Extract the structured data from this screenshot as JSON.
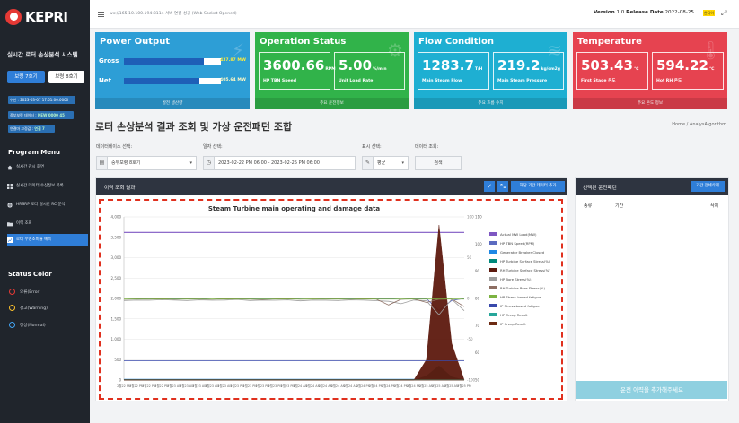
{
  "sidebar": {
    "logo_text": "KEPRI",
    "system_title": "실시간 로터 손상분석 시스템",
    "unit_buttons": [
      "보령 7호기",
      "보령 8호기"
    ],
    "info": [
      {
        "label": "수신 :",
        "value": "2023-03-07 17:51:00.0000"
      },
      {
        "label": "중부보령 데이터 :",
        "value": "NEW 0000 45"
      },
      {
        "label": "연결마 고정값 :",
        "value": "연결 7"
      }
    ],
    "menu_title": "Program Menu",
    "menu": [
      {
        "icon": "home-icon",
        "label": "실시간 감시 화면"
      },
      {
        "icon": "grid-icon",
        "label": "실시간 데이터 수신정보 목록"
      },
      {
        "icon": "globe-icon",
        "label": "HRSRP 로터 실시간 RC 분석"
      },
      {
        "icon": "folder-icon",
        "label": "이력 조회"
      },
      {
        "icon": "chart-icon",
        "label": "로터 수명소비율 예측"
      }
    ],
    "status_title": "Status Color",
    "statuses": [
      {
        "label": "오류(Error)",
        "color": "#e53935"
      },
      {
        "label": "경고(Warning)",
        "color": "#fbc02d"
      },
      {
        "label": "정상(Normal)",
        "color": "#42a5f5"
      }
    ]
  },
  "topbar": {
    "connection_text": "ws://165.10.100.194:8114 서버 연결 성공 (Web Socket Opened)",
    "version_label": "Version",
    "version": "1.0",
    "release_label": "Release Date",
    "release_date": "2022-08-25",
    "lang_badge": "한국어"
  },
  "cards": {
    "power": {
      "title": "Power Output",
      "rows": [
        {
          "label": "Gross",
          "value": "437.87",
          "unit": "MW",
          "fill_fraction": 0.82
        },
        {
          "label": "Net",
          "value": "405.64",
          "unit": "MW",
          "fill_fraction": 0.78
        }
      ],
      "footer": "발전 생산량"
    },
    "operation": {
      "title": "Operation Status",
      "items": [
        {
          "value": "3600.66",
          "unit": "RPM",
          "label": "HP TBN Speed"
        },
        {
          "value": "5.00",
          "unit": "%/min",
          "label": "Unit Load Rate"
        }
      ],
      "footer": "주요 운전정보"
    },
    "flow": {
      "title": "Flow Condition",
      "items": [
        {
          "value": "1283.7",
          "unit": "T/H",
          "label": "Main Steam Flow"
        },
        {
          "value": "219.2",
          "unit": "kg/cm2g",
          "label": "Main Steam Pressure"
        }
      ],
      "footer": "주요 흐름 수치"
    },
    "temperature": {
      "title": "Temperature",
      "items": [
        {
          "value": "503.43",
          "unit": "℃",
          "label": "First Stage 온도"
        },
        {
          "value": "594.22",
          "unit": "℃",
          "label": "Hot RH 온도"
        }
      ],
      "footer": "주요 온도 정보"
    }
  },
  "page": {
    "title": "로터 손상분석 결과 조회 및 가상 운전패턴 조합",
    "breadcrumb": "Home / AnalysAlgorithm"
  },
  "filters": {
    "database_label": "데이터베이스 선택:",
    "database_value": "중부보령 8호기",
    "date_label": "일자 선택:",
    "date_value": "2023-02-22 PM 06:00 - 2023-02-25 PM 06:00",
    "display_label": "표시 선택:",
    "display_value": "평균",
    "query_label": "데이터 조회:",
    "query_button": "검색"
  },
  "results": {
    "title": "이력 조회 결과",
    "save_button": "해당 기간 데이터 추가"
  },
  "pattern": {
    "title": "선택된 운전패턴",
    "delete_button": "기간 전체삭제",
    "columns": [
      "종류",
      "기간",
      "삭제"
    ],
    "add_button": "운전 이력을 추가해주세요"
  },
  "chart_data": {
    "type": "line",
    "title": "Steam Turbine main operating and damage data",
    "y_left_ticks": [
      "4,000",
      "3,500",
      "3,000",
      "2,500",
      "2,000",
      "1,500",
      "1,000",
      "500",
      "0"
    ],
    "y_right_outer_ticks": [
      "110",
      "100",
      "90",
      "80",
      "70",
      "60",
      "50"
    ],
    "y_right_inner_ticks": [
      "100",
      "50",
      "0",
      "-50",
      "-100"
    ],
    "ylim_left": [
      0,
      4000
    ],
    "grid": true,
    "legend_placement": "right",
    "x": [
      "2월22 PM",
      "2월22 PM",
      "2월22 PM",
      "2월22 PM",
      "2월23 AM",
      "2월23 AM",
      "2월23 AM",
      "2월23 AM",
      "2월23 AM",
      "2월23 PM",
      "2월23 PM",
      "2월23 PM",
      "2월23 PM",
      "2월23 PM",
      "2월24 AM",
      "2월24 AM",
      "2월24 AM",
      "2월24 AM",
      "2월24 AM",
      "2월24 PM",
      "2월24 PM",
      "2월24 PM",
      "2월24 PM",
      "2월24 PM",
      "2월25 AM",
      "2월25 AM",
      "2월25 AM",
      "2월25 PM"
    ],
    "series": [
      {
        "name": "Actual MW Load(MW)",
        "color": "#7e57c2",
        "values": [
          3620,
          3620,
          3620,
          3620,
          3620,
          3620,
          3620,
          3620,
          3620,
          3620,
          3620,
          3620,
          3620,
          3620,
          3620,
          3620,
          3620,
          3620,
          3620,
          3620,
          3620,
          3620,
          3620,
          3620,
          3620,
          3620,
          3620,
          3620
        ]
      },
      {
        "name": "HP TBN Speed(RPM)",
        "color": "#5c6bc0",
        "values": [
          2010,
          2000,
          1990,
          2005,
          1995,
          2000,
          1985,
          2010,
          1990,
          2000,
          1995,
          2005,
          2000,
          1985,
          2000,
          2010,
          1990,
          2000,
          1995,
          2005,
          1990,
          2000,
          1980,
          2000,
          1995,
          1700,
          1950,
          2000
        ]
      },
      {
        "name": "Generator Breaker Closed",
        "color": "#1e88e5",
        "values": [
          20,
          20,
          20,
          20,
          20,
          20,
          20,
          20,
          20,
          20,
          20,
          20,
          20,
          20,
          20,
          20,
          20,
          20,
          20,
          20,
          20,
          20,
          20,
          20,
          20,
          20,
          20,
          20
        ]
      },
      {
        "name": "HP Turbine Surface Stress(%)",
        "color": "#00897b",
        "values": [
          0,
          0,
          0,
          0,
          0,
          0,
          0,
          0,
          0,
          0,
          0,
          0,
          0,
          0,
          0,
          0,
          0,
          0,
          0,
          0,
          0,
          0,
          0,
          0,
          100,
          350,
          80,
          0
        ]
      },
      {
        "name": "RH Turbine Surface Stress(%)",
        "color": "#5d1a0e",
        "values": [
          0,
          0,
          0,
          0,
          0,
          0,
          0,
          0,
          0,
          0,
          0,
          0,
          0,
          0,
          0,
          0,
          0,
          0,
          0,
          0,
          0,
          0,
          0,
          0,
          500,
          3800,
          900,
          0
        ]
      },
      {
        "name": "HP Bore Stress(%)",
        "color": "#9e9e9e",
        "values": [
          1950,
          1960,
          1955,
          1970,
          1960,
          1950,
          1965,
          1955,
          1960,
          1975,
          1950,
          1960,
          1955,
          1965,
          1940,
          1960,
          1955,
          1950,
          1965,
          1960,
          1945,
          1930,
          1870,
          1960,
          1940,
          1600,
          1980,
          1700
        ]
      },
      {
        "name": "RH Turbine Bore Stress(%)",
        "color": "#8d6e63",
        "values": [
          1980,
          1990,
          1985,
          1995,
          1980,
          1990,
          1985,
          1980,
          1995,
          1990,
          1985,
          1975,
          1990,
          1995,
          1980,
          1990,
          1985,
          1990,
          1980,
          1995,
          1985,
          1840,
          1980,
          1990,
          1900,
          1980,
          1990,
          1800
        ]
      },
      {
        "name": "HP Stress-based fatigue",
        "color": "#7cb342",
        "values": [
          1985,
          1985,
          1985,
          1985,
          1985,
          1985,
          1985,
          1985,
          1985,
          1985,
          1985,
          1985,
          1985,
          1985,
          1985,
          1985,
          1985,
          1985,
          1985,
          1985,
          1985,
          1985,
          1985,
          1985,
          1985,
          1985,
          1985,
          1985
        ]
      },
      {
        "name": "IP Stress-based fatigue",
        "color": "#3949ab",
        "values": [
          470,
          470,
          470,
          470,
          470,
          470,
          470,
          470,
          470,
          470,
          470,
          470,
          470,
          470,
          470,
          470,
          470,
          470,
          470,
          470,
          470,
          470,
          470,
          470,
          470,
          470,
          470,
          470
        ]
      },
      {
        "name": "HP Creep Result",
        "color": "#26a69a",
        "values": [
          10,
          10,
          10,
          10,
          10,
          10,
          10,
          10,
          10,
          10,
          10,
          10,
          10,
          10,
          10,
          10,
          10,
          10,
          10,
          10,
          10,
          10,
          10,
          10,
          10,
          10,
          10,
          10
        ]
      },
      {
        "name": "IP Creep Result",
        "color": "#6d2b13",
        "values": [
          5,
          5,
          5,
          5,
          5,
          5,
          5,
          5,
          5,
          5,
          5,
          5,
          5,
          5,
          5,
          5,
          5,
          5,
          5,
          5,
          5,
          5,
          5,
          5,
          5,
          5,
          5,
          5
        ]
      }
    ]
  }
}
